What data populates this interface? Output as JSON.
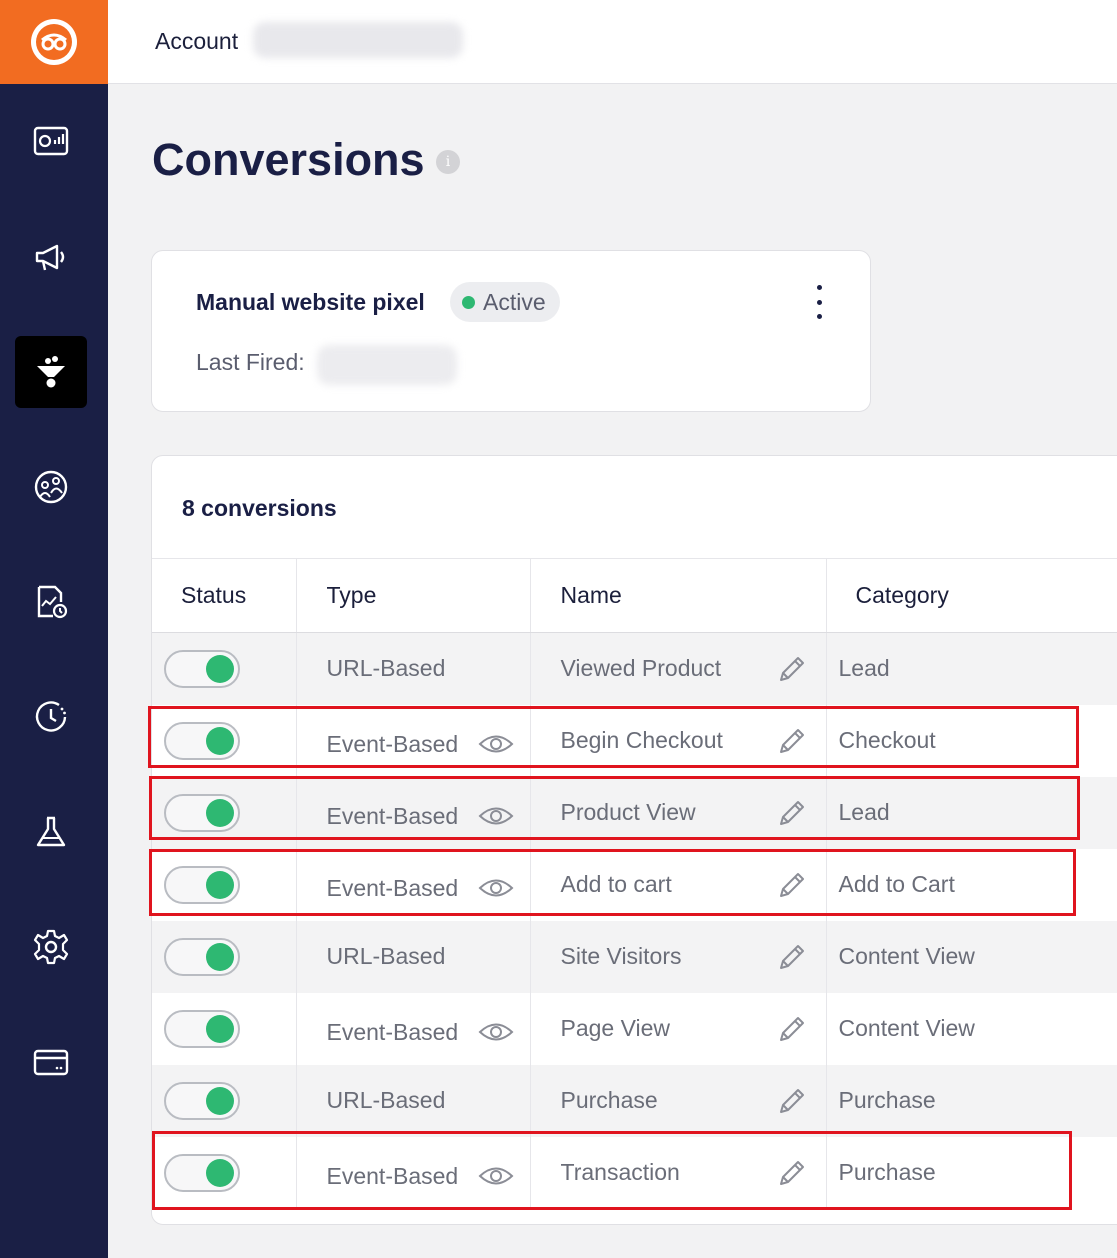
{
  "header": {
    "account_label": "Account"
  },
  "page": {
    "title": "Conversions"
  },
  "pixel": {
    "name": "Manual website pixel",
    "status": "Active",
    "last_fired_label": "Last Fired:"
  },
  "conversions": {
    "count_label": "8 conversions",
    "columns": {
      "status": "Status",
      "type": "Type",
      "name": "Name",
      "category": "Category"
    },
    "rows": [
      {
        "enabled": true,
        "type": "URL-Based",
        "name": "Viewed Product",
        "category": "Lead",
        "highlighted": false
      },
      {
        "enabled": true,
        "type": "Event-Based",
        "name": "Begin Checkout",
        "category": "Checkout",
        "highlighted": true
      },
      {
        "enabled": true,
        "type": "Event-Based",
        "name": "Product View",
        "category": "Lead",
        "highlighted": true
      },
      {
        "enabled": true,
        "type": "Event-Based",
        "name": "Add to cart",
        "category": "Add to Cart",
        "highlighted": true
      },
      {
        "enabled": true,
        "type": "URL-Based",
        "name": "Site Visitors",
        "category": "Content View",
        "highlighted": false
      },
      {
        "enabled": true,
        "type": "Event-Based",
        "name": "Page View",
        "category": "Content View",
        "highlighted": false
      },
      {
        "enabled": true,
        "type": "URL-Based",
        "name": "Purchase",
        "category": "Purchase",
        "highlighted": false
      },
      {
        "enabled": true,
        "type": "Event-Based",
        "name": "Transaction",
        "category": "Purchase",
        "highlighted": true
      }
    ]
  },
  "sidebar": {
    "items": [
      {
        "icon": "dashboard-icon",
        "active": false
      },
      {
        "icon": "megaphone-icon",
        "active": false
      },
      {
        "icon": "funnel-icon",
        "active": true
      },
      {
        "icon": "audience-icon",
        "active": false
      },
      {
        "icon": "report-icon",
        "active": false
      },
      {
        "icon": "history-icon",
        "active": false
      },
      {
        "icon": "flask-icon",
        "active": false
      },
      {
        "icon": "gear-icon",
        "active": false
      },
      {
        "icon": "billing-card-icon",
        "active": false
      }
    ]
  },
  "colors": {
    "brand": "#f26c21",
    "sidebar": "#1a1f45",
    "active_green": "#2eb872",
    "highlight": "#e0141e"
  }
}
